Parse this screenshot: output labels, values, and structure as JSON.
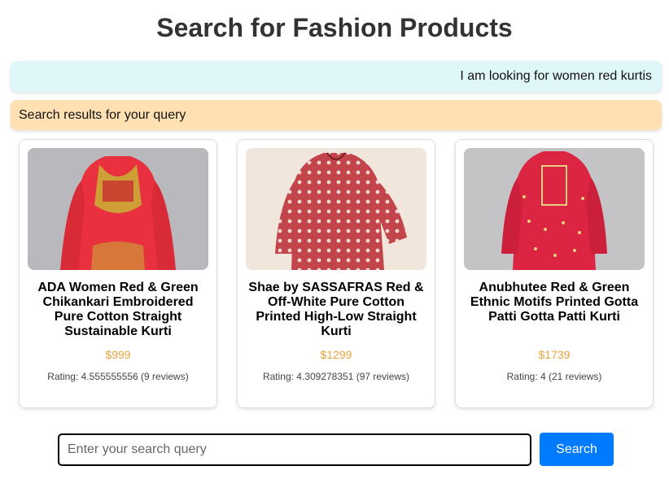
{
  "page": {
    "title": "Search for Fashion Products"
  },
  "chat": {
    "user_message": "I am looking for women red kurtis",
    "bot_message": "Search results for your query"
  },
  "products": [
    {
      "name": "ADA Women Red & Green Chikankari Embroidered Pure Cotton Straight Sustainable Kurti",
      "price": "$999",
      "rating": "Rating: 4.555555556 (9 reviews)",
      "image_bg": "#b9b8bd",
      "garment_color": "#e8303e",
      "accent_color": "#c9b236"
    },
    {
      "name": "Shae by SASSAFRAS Red & Off-White Pure Cotton Printed High-Low Straight Kurti",
      "price": "$1299",
      "rating": "Rating: 4.309278351 (97 reviews)",
      "image_bg": "#f1e6dc",
      "garment_color": "#c2454b",
      "accent_color": "#f0d6cf"
    },
    {
      "name": "Anubhutee Red & Green Ethnic Motifs Printed Gotta Patti Gotta Patti Kurti",
      "price": "$1739",
      "rating": "Rating: 4 (21 reviews)",
      "image_bg": "#c4c3c6",
      "garment_color": "#dc2443",
      "accent_color": "#e9cf7e"
    }
  ],
  "search": {
    "placeholder": "Enter your search query",
    "value": "",
    "button_label": "Search"
  },
  "colors": {
    "user_bubble": "#e0f7fa",
    "bot_bubble": "#ffe0b2",
    "price": "#e8a23b",
    "button": "#007bff"
  }
}
